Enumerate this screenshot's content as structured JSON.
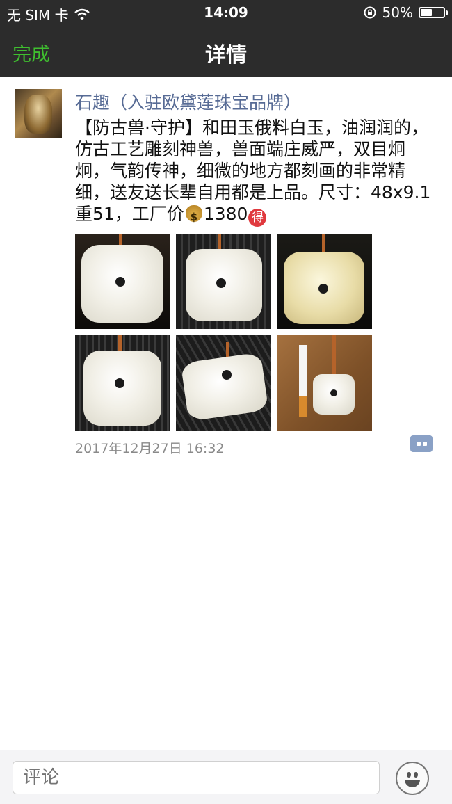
{
  "status_bar": {
    "carrier": "无 SIM 卡",
    "time": "14:09",
    "battery_percent": "50%",
    "battery_level": 0.5
  },
  "nav": {
    "back_label": "完成",
    "title": "详情"
  },
  "post": {
    "author": "石趣（入驻欧黛莲珠宝品牌）",
    "text_before_price": "【防古兽·守护】和田玉俄料白玉，油润润的，仿古工艺雕刻神兽，兽面端庄威严，双目炯炯，气韵传神，细微的地方都刻画的非常精细，送友送长辈自用都是上品。尺寸：48x9.1重51，工厂价",
    "price": "1380",
    "emoji_moneybag": "money-bag-emoji",
    "emoji_de": "得",
    "photo_count": 6,
    "timestamp": "2017年12月27日 16:32"
  },
  "comment_bar": {
    "placeholder": "评论"
  },
  "colors": {
    "nav_background": "#2c2c2c",
    "accent_green": "#3fbf2f",
    "author_blue": "#576b95"
  }
}
